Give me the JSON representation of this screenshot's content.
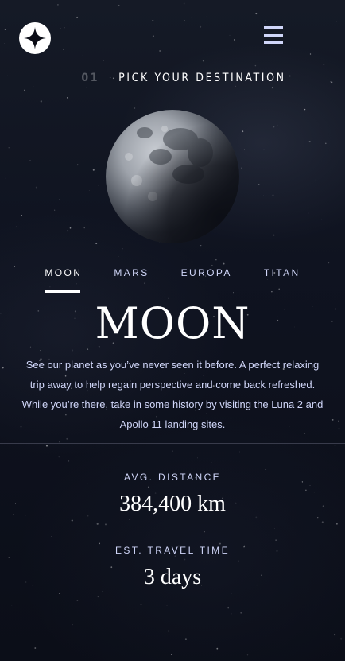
{
  "header": {
    "logo_icon": "star-logo-icon",
    "menu_icon": "hamburger-menu-icon"
  },
  "subheading": {
    "number": "01",
    "label": "PICK YOUR DESTINATION"
  },
  "destination_image": "moon",
  "tabs": [
    {
      "label": "MOON",
      "active": true
    },
    {
      "label": "MARS",
      "active": false
    },
    {
      "label": "EUROPA",
      "active": false
    },
    {
      "label": "TITAN",
      "active": false
    }
  ],
  "destination": {
    "name": "MOON",
    "description": "See our planet as you’ve never seen it before. A perfect relaxing trip away to help regain perspective and come back refreshed. While you’re there, take in some history by visiting the Luna 2 and Apollo 11 landing sites."
  },
  "stats": {
    "distance": {
      "label": "AVG. DISTANCE",
      "value": "384,400 km"
    },
    "travel_time": {
      "label": "EST. TRAVEL TIME",
      "value": "3 days"
    }
  },
  "colors": {
    "background": "#0b0d17",
    "accent": "#d0d6f9",
    "white": "#ffffff"
  }
}
